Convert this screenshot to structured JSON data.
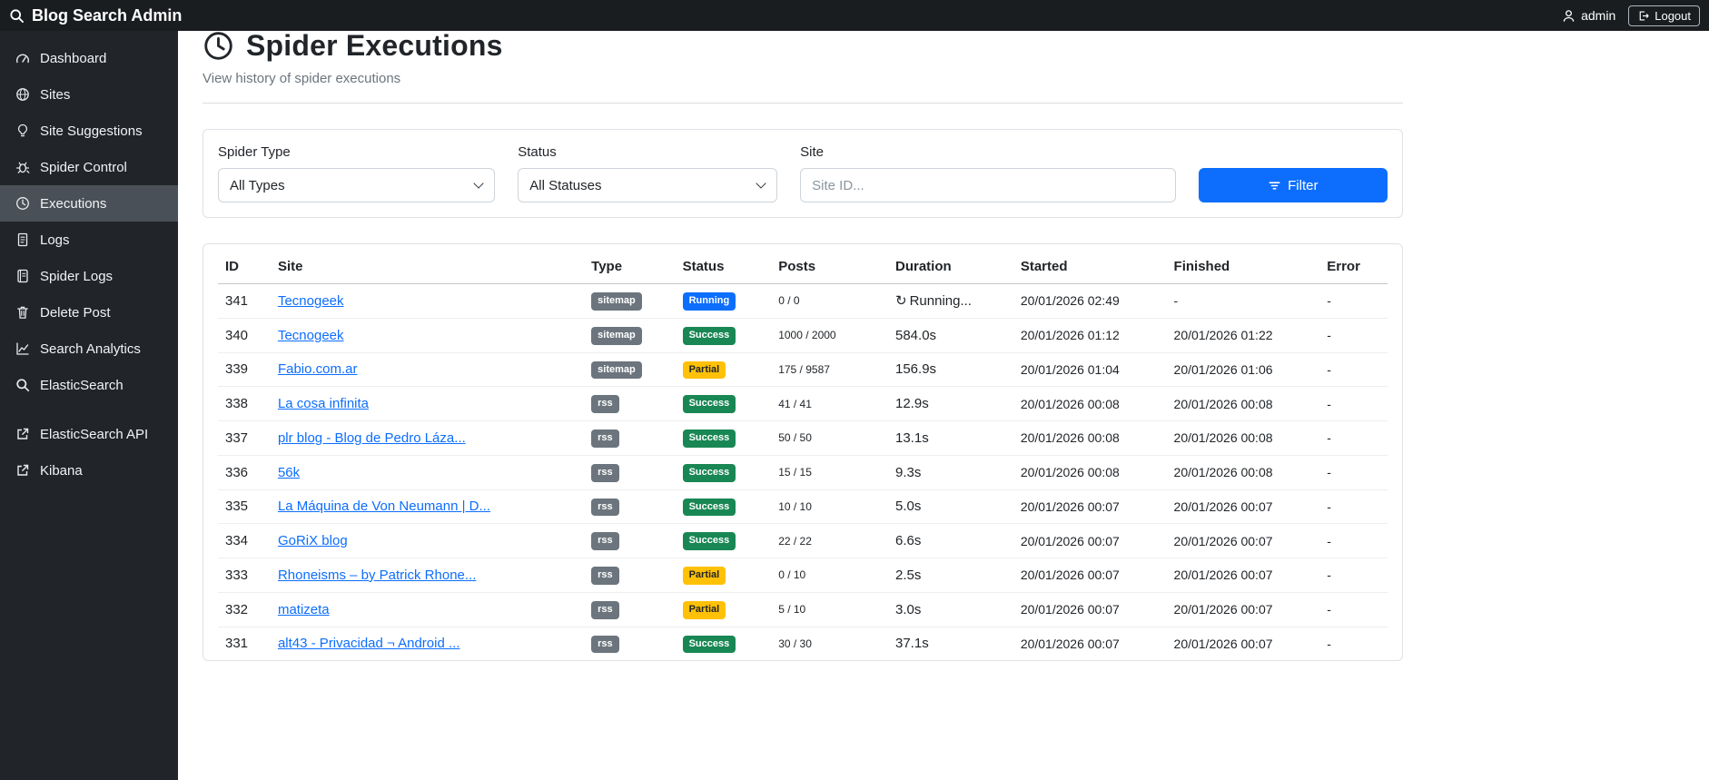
{
  "navbar": {
    "brand": "Blog Search Admin",
    "user": "admin",
    "logout_label": "Logout"
  },
  "sidebar": {
    "items": [
      {
        "label": "Dashboard",
        "icon": "speedometer",
        "active": false
      },
      {
        "label": "Sites",
        "icon": "globe",
        "active": false
      },
      {
        "label": "Site Suggestions",
        "icon": "lightbulb",
        "active": false
      },
      {
        "label": "Spider Control",
        "icon": "bug",
        "active": false
      },
      {
        "label": "Executions",
        "icon": "clock",
        "active": true
      },
      {
        "label": "Logs",
        "icon": "file",
        "active": false
      },
      {
        "label": "Spider Logs",
        "icon": "journal",
        "active": false
      },
      {
        "label": "Delete Post",
        "icon": "trash",
        "active": false
      },
      {
        "label": "Search Analytics",
        "icon": "graph",
        "active": false
      },
      {
        "label": "ElasticSearch",
        "icon": "search",
        "active": false
      },
      {
        "label": "ElasticSearch API",
        "icon": "external",
        "active": false,
        "divider_before": true
      },
      {
        "label": "Kibana",
        "icon": "external",
        "active": false
      }
    ]
  },
  "page": {
    "title": "Spider Executions",
    "subtitle": "View history of spider executions"
  },
  "filters": {
    "spider_type_label": "Spider Type",
    "spider_type_value": "All Types",
    "status_label": "Status",
    "status_value": "All Statuses",
    "site_label": "Site",
    "site_placeholder": "Site ID...",
    "filter_button": "Filter"
  },
  "colors": {
    "accent": "#0d6efd",
    "type_badge": "#6c757d",
    "status": {
      "Running": "#0d6efd",
      "Success": "#198754",
      "Partial": "#ffc107"
    },
    "status_text": {
      "Running": "#ffffff",
      "Success": "#ffffff",
      "Partial": "#212529"
    }
  },
  "table": {
    "columns": [
      "ID",
      "Site",
      "Type",
      "Status",
      "Posts",
      "Duration",
      "Started",
      "Finished",
      "Error"
    ],
    "rows": [
      {
        "id": "341",
        "site": "Tecnogeek",
        "type": "sitemap",
        "status": "Running",
        "posts": "0 / 0",
        "duration": "Running...",
        "running": true,
        "started": "20/01/2026 02:49",
        "finished": "-",
        "error": "-"
      },
      {
        "id": "340",
        "site": "Tecnogeek",
        "type": "sitemap",
        "status": "Success",
        "posts": "1000 / 2000",
        "duration": "584.0s",
        "running": false,
        "started": "20/01/2026 01:12",
        "finished": "20/01/2026 01:22",
        "error": "-"
      },
      {
        "id": "339",
        "site": "Fabio.com.ar",
        "type": "sitemap",
        "status": "Partial",
        "posts": "175 / 9587",
        "duration": "156.9s",
        "running": false,
        "started": "20/01/2026 01:04",
        "finished": "20/01/2026 01:06",
        "error": "-"
      },
      {
        "id": "338",
        "site": "La cosa infinita",
        "type": "rss",
        "status": "Success",
        "posts": "41 / 41",
        "duration": "12.9s",
        "running": false,
        "started": "20/01/2026 00:08",
        "finished": "20/01/2026 00:08",
        "error": "-"
      },
      {
        "id": "337",
        "site": "plr blog - Blog de Pedro Láza...",
        "type": "rss",
        "status": "Success",
        "posts": "50 / 50",
        "duration": "13.1s",
        "running": false,
        "started": "20/01/2026 00:08",
        "finished": "20/01/2026 00:08",
        "error": "-"
      },
      {
        "id": "336",
        "site": "56k",
        "type": "rss",
        "status": "Success",
        "posts": "15 / 15",
        "duration": "9.3s",
        "running": false,
        "started": "20/01/2026 00:08",
        "finished": "20/01/2026 00:08",
        "error": "-"
      },
      {
        "id": "335",
        "site": "La Máquina de Von Neumann | D...",
        "type": "rss",
        "status": "Success",
        "posts": "10 / 10",
        "duration": "5.0s",
        "running": false,
        "started": "20/01/2026 00:07",
        "finished": "20/01/2026 00:07",
        "error": "-"
      },
      {
        "id": "334",
        "site": "GoRiX blog",
        "type": "rss",
        "status": "Success",
        "posts": "22 / 22",
        "duration": "6.6s",
        "running": false,
        "started": "20/01/2026 00:07",
        "finished": "20/01/2026 00:07",
        "error": "-"
      },
      {
        "id": "333",
        "site": "Rhoneisms – by Patrick Rhone...",
        "type": "rss",
        "status": "Partial",
        "posts": "0 / 10",
        "duration": "2.5s",
        "running": false,
        "started": "20/01/2026 00:07",
        "finished": "20/01/2026 00:07",
        "error": "-"
      },
      {
        "id": "332",
        "site": "matizeta",
        "type": "rss",
        "status": "Partial",
        "posts": "5 / 10",
        "duration": "3.0s",
        "running": false,
        "started": "20/01/2026 00:07",
        "finished": "20/01/2026 00:07",
        "error": "-"
      },
      {
        "id": "331",
        "site": "alt43 - Privacidad ¬ Android ...",
        "type": "rss",
        "status": "Success",
        "posts": "30 / 30",
        "duration": "37.1s",
        "running": false,
        "started": "20/01/2026 00:07",
        "finished": "20/01/2026 00:07",
        "error": "-"
      }
    ]
  }
}
